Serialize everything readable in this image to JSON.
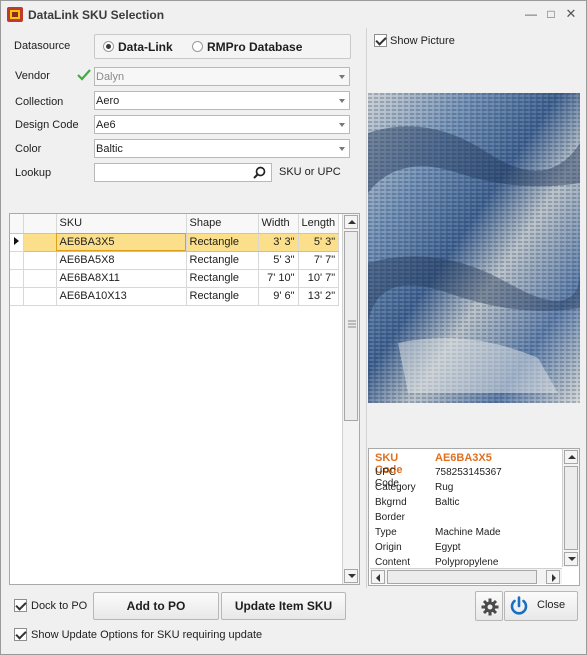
{
  "window": {
    "title": "DataLink SKU Selection"
  },
  "datasource": {
    "label": "Datasource",
    "option1": "Data-Link",
    "option2": "RMPro Database",
    "selected": "Data-Link"
  },
  "fields": {
    "vendor_label": "Vendor",
    "vendor_value": "Dalyn",
    "collection_label": "Collection",
    "collection_value": "Aero",
    "design_label": "Design Code",
    "design_value": "Ae6",
    "color_label": "Color",
    "color_value": "Baltic",
    "lookup_label": "Lookup",
    "lookup_value": "",
    "lookup_hint": "SKU or UPC"
  },
  "grid": {
    "columns": [
      "SKU",
      "Shape",
      "Width",
      "Length"
    ],
    "rows": [
      {
        "sku": "AE6BA3X5",
        "shape": "Rectangle",
        "width": "3' 3\"",
        "length": "5' 3\"",
        "selected": true
      },
      {
        "sku": "AE6BA5X8",
        "shape": "Rectangle",
        "width": "5' 3\"",
        "length": "7' 7\"",
        "selected": false
      },
      {
        "sku": "AE6BA8X11",
        "shape": "Rectangle",
        "width": "7' 10\"",
        "length": "10' 7\"",
        "selected": false
      },
      {
        "sku": "AE6BA10X13",
        "shape": "Rectangle",
        "width": "9' 6\"",
        "length": "13' 2\"",
        "selected": false
      }
    ]
  },
  "show_picture": {
    "label": "Show Picture",
    "checked": true
  },
  "properties": {
    "title_key": "SKU Code",
    "title_value": "AE6BA3X5",
    "rows": [
      {
        "k": "UPC Code",
        "v": "758253145367"
      },
      {
        "k": "Category",
        "v": "Rug"
      },
      {
        "k": "Bkgrnd",
        "v": "Baltic"
      },
      {
        "k": "Border",
        "v": ""
      },
      {
        "k": "Type",
        "v": "Machine Made"
      },
      {
        "k": "Origin",
        "v": "Egypt"
      },
      {
        "k": "Content",
        "v": "Polypropylene"
      }
    ]
  },
  "bottom": {
    "dock_label": "Dock to PO",
    "dock_checked": true,
    "add_label": "Add to PO",
    "update_label": "Update Item SKU",
    "close_label": "Close",
    "options_label": "Show Update Options for SKU requiring update",
    "options_checked": true
  },
  "colors": {
    "accent_orange": "#e07020",
    "selected_row": "#fcdf8a",
    "check_green": "#44aa44",
    "power_blue": "#1a6fc4"
  }
}
